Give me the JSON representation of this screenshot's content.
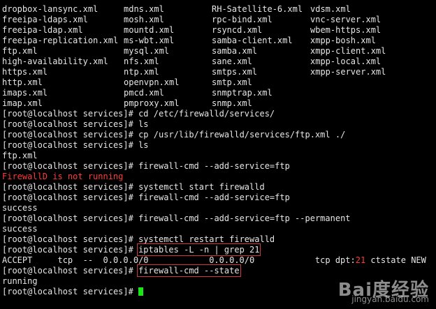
{
  "files": [
    [
      "dropbox-lansync.xml",
      "mdns.xml",
      "RH-Satellite-6.xml",
      "vdsm.xml"
    ],
    [
      "freeipa-ldaps.xml",
      "mosh.xml",
      "rpc-bind.xml",
      "vnc-server.xml"
    ],
    [
      "freeipa-ldap.xml",
      "mountd.xml",
      "rsyncd.xml",
      "wbem-https.xml"
    ],
    [
      "freeipa-replication.xml",
      "ms-wbt.xml",
      "samba-client.xml",
      "xmpp-bosh.xml"
    ],
    [
      "ftp.xml",
      "mysql.xml",
      "samba.xml",
      "xmpp-client.xml"
    ],
    [
      "high-availability.xml",
      "nfs.xml",
      "sane.xml",
      "xmpp-local.xml"
    ],
    [
      "https.xml",
      "ntp.xml",
      "smtps.xml",
      "xmpp-server.xml"
    ],
    [
      "http.xml",
      "openvpn.xml",
      "smtp.xml",
      ""
    ],
    [
      "imaps.xml",
      "pmcd.xml",
      "snmptrap.xml",
      ""
    ],
    [
      "imap.xml",
      "pmproxy.xml",
      "snmp.xml",
      ""
    ]
  ],
  "prompt": "[root@localhost services]# ",
  "session": {
    "cmd1": "cd /etc/firewalld/services/",
    "cmd2": "ls",
    "cmd3": "cp /usr/lib/firewalld/services/ftp.xml ./",
    "cmd4": "ls",
    "out4": "ftp.xml",
    "cmd5": "firewall-cmd --add-service=ftp",
    "err5": "FirewallD is not running",
    "cmd6": "systemctl start firewalld",
    "cmd7": "firewall-cmd --add-service=ftp",
    "out7": "success",
    "cmd8": "firewall-cmd --add-service=ftp --permanent",
    "out8": "success",
    "cmd9": "systemctl restart firewalld",
    "cmd10": "iptables -L -n | grep 21",
    "out10_pre": "ACCEPT     tcp  --  0.0.0.0/0            0.0.0.0/0            tcp dpt:",
    "out10_port": "21",
    "out10_post": " ctstate NEW",
    "cmd11": "firewall-cmd --state",
    "out11": "running"
  },
  "watermark": {
    "brand": "Bai度经验",
    "site": "jingyan.baidu.com"
  },
  "colors": {
    "error": "#ff3b3b",
    "cursor": "#19e619",
    "highlight_box": "#d23a3a"
  }
}
